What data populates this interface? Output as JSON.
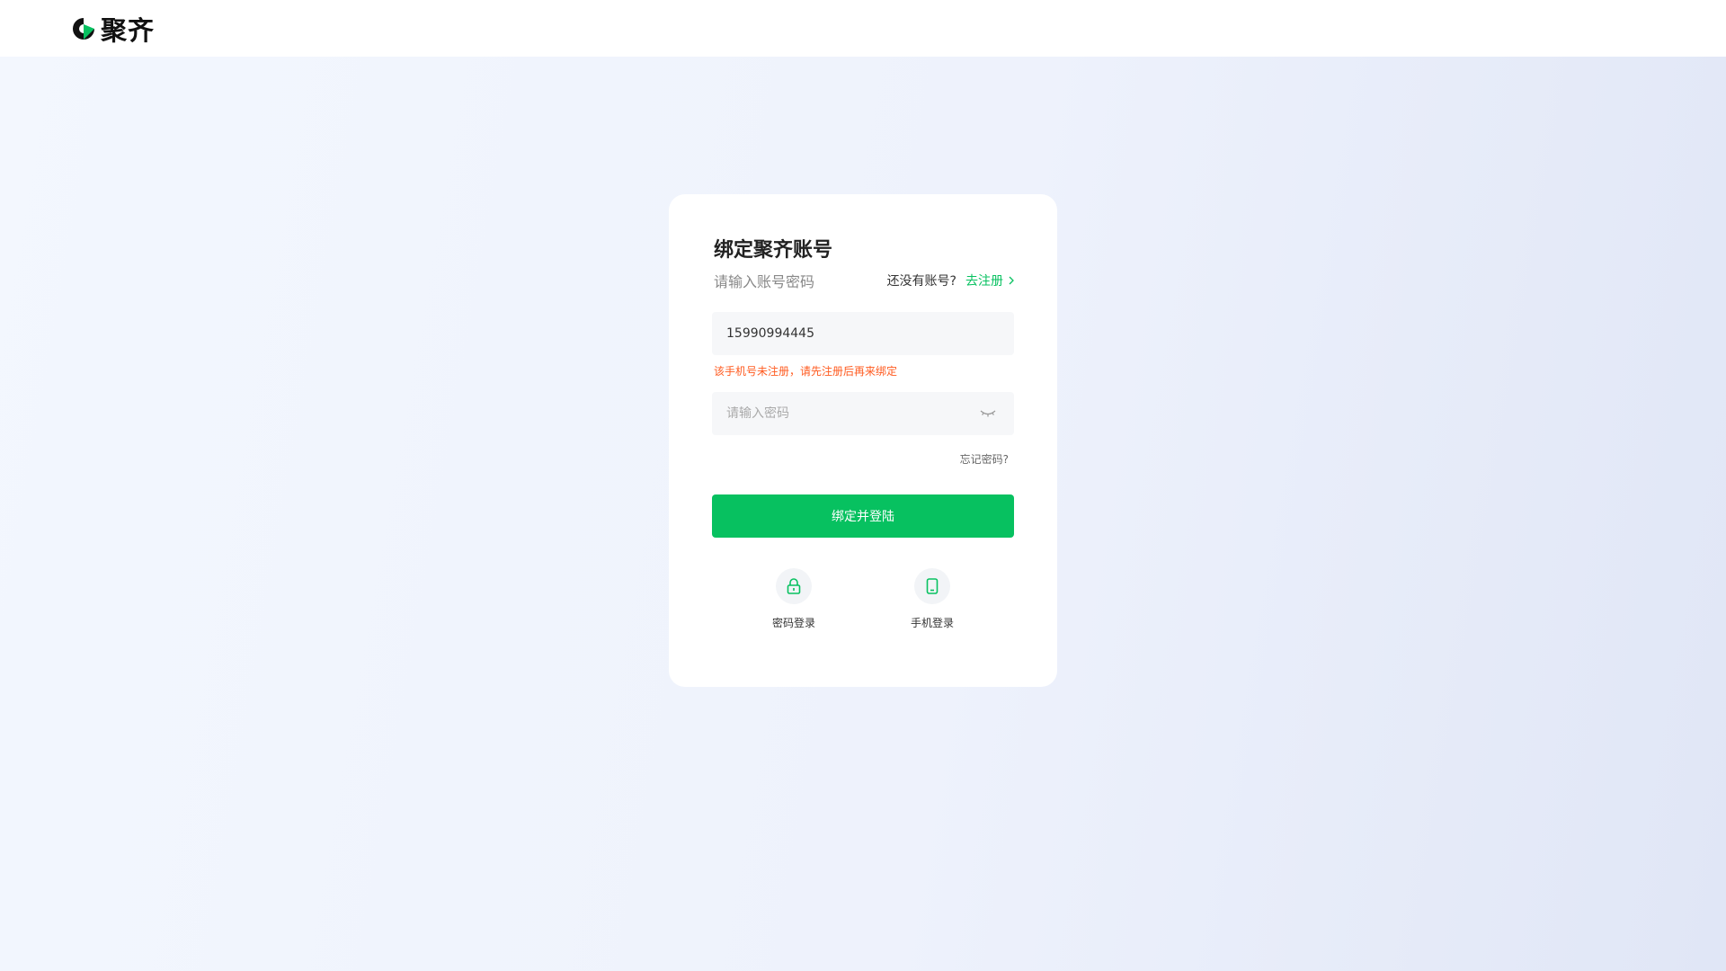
{
  "header": {
    "logo_text": "聚齐"
  },
  "card": {
    "title": "绑定聚齐账号",
    "subtitle": "请输入账号密码",
    "no_account_text": "还没有账号?",
    "register_link": "去注册",
    "phone_value": "15990994445",
    "error_message": "该手机号未注册，请先注册后再来绑定",
    "password_placeholder": "请输入密码",
    "forgot_password": "忘记密码?",
    "submit_label": "绑定并登陆",
    "alt_logins": [
      {
        "label": "密码登录",
        "icon": "lock-icon"
      },
      {
        "label": "手机登录",
        "icon": "phone-icon"
      }
    ]
  },
  "colors": {
    "accent": "#07c160",
    "error": "#ff5a1f"
  }
}
